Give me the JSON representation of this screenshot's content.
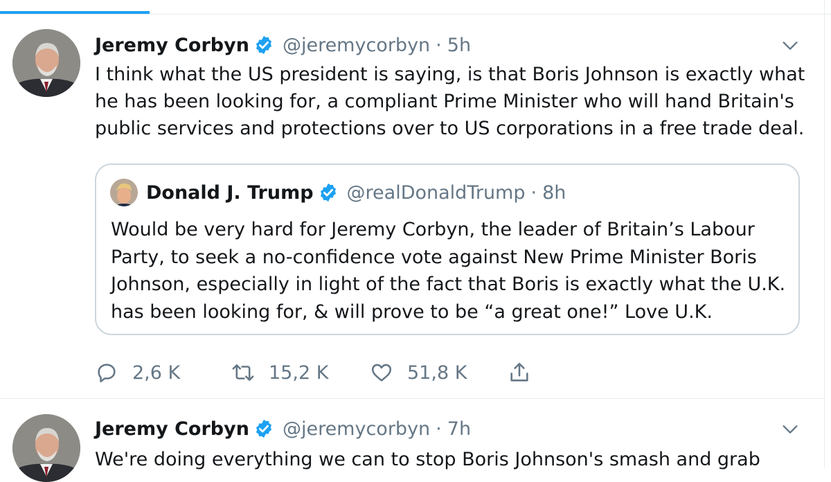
{
  "tweets": [
    {
      "author": {
        "name": "Jeremy Corbyn",
        "handle": "@jeremycorbyn"
      },
      "time": "5h",
      "text_lines": [
        "I think what the US president is saying, is that Boris Johnson is exactly what",
        "he has been looking for, a compliant Prime Minister who will hand Britain's",
        "public services and protections over to US corporations in a free trade deal."
      ],
      "quote": {
        "author": {
          "name": "Donald J. Trump",
          "handle": "@realDonaldTrump"
        },
        "time": "8h",
        "text_lines": [
          "Would be very hard for Jeremy Corbyn, the leader of Britain’s Labour",
          "Party, to seek a no-confidence vote against New Prime Minister Boris",
          "Johnson, especially in light of the fact that Boris is exactly what the U.K.",
          "has been looking for, & will prove to be “a great one!” Love U.K."
        ]
      },
      "actions": {
        "replies": "2,6 K",
        "retweets": "15,2 K",
        "likes": "51,8 K"
      }
    },
    {
      "author": {
        "name": "Jeremy Corbyn",
        "handle": "@jeremycorbyn"
      },
      "time": "7h",
      "text_lines": [
        "We're doing everything we can to stop Boris Johnson's smash and grab"
      ]
    }
  ],
  "separator": "·",
  "icons": {
    "verified": "verified-badge-icon",
    "caret": "chevron-down-icon",
    "reply": "reply-icon",
    "retweet": "retweet-icon",
    "like": "heart-icon",
    "share": "share-icon"
  },
  "colors": {
    "accent": "#1da1f2",
    "text": "#14171a",
    "muted": "#657786",
    "border": "#ccd6dd"
  }
}
